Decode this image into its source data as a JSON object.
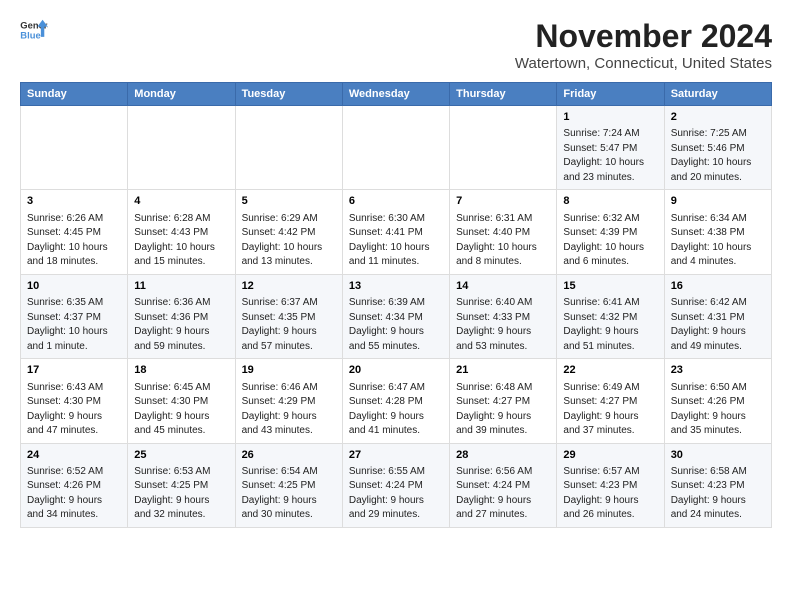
{
  "header": {
    "logo_line1": "General",
    "logo_line2": "Blue",
    "title": "November 2024",
    "subtitle": "Watertown, Connecticut, United States"
  },
  "weekdays": [
    "Sunday",
    "Monday",
    "Tuesday",
    "Wednesday",
    "Thursday",
    "Friday",
    "Saturday"
  ],
  "weeks": [
    [
      {
        "day": "",
        "info": ""
      },
      {
        "day": "",
        "info": ""
      },
      {
        "day": "",
        "info": ""
      },
      {
        "day": "",
        "info": ""
      },
      {
        "day": "",
        "info": ""
      },
      {
        "day": "1",
        "info": "Sunrise: 7:24 AM\nSunset: 5:47 PM\nDaylight: 10 hours\nand 23 minutes."
      },
      {
        "day": "2",
        "info": "Sunrise: 7:25 AM\nSunset: 5:46 PM\nDaylight: 10 hours\nand 20 minutes."
      }
    ],
    [
      {
        "day": "3",
        "info": "Sunrise: 6:26 AM\nSunset: 4:45 PM\nDaylight: 10 hours\nand 18 minutes."
      },
      {
        "day": "4",
        "info": "Sunrise: 6:28 AM\nSunset: 4:43 PM\nDaylight: 10 hours\nand 15 minutes."
      },
      {
        "day": "5",
        "info": "Sunrise: 6:29 AM\nSunset: 4:42 PM\nDaylight: 10 hours\nand 13 minutes."
      },
      {
        "day": "6",
        "info": "Sunrise: 6:30 AM\nSunset: 4:41 PM\nDaylight: 10 hours\nand 11 minutes."
      },
      {
        "day": "7",
        "info": "Sunrise: 6:31 AM\nSunset: 4:40 PM\nDaylight: 10 hours\nand 8 minutes."
      },
      {
        "day": "8",
        "info": "Sunrise: 6:32 AM\nSunset: 4:39 PM\nDaylight: 10 hours\nand 6 minutes."
      },
      {
        "day": "9",
        "info": "Sunrise: 6:34 AM\nSunset: 4:38 PM\nDaylight: 10 hours\nand 4 minutes."
      }
    ],
    [
      {
        "day": "10",
        "info": "Sunrise: 6:35 AM\nSunset: 4:37 PM\nDaylight: 10 hours\nand 1 minute."
      },
      {
        "day": "11",
        "info": "Sunrise: 6:36 AM\nSunset: 4:36 PM\nDaylight: 9 hours\nand 59 minutes."
      },
      {
        "day": "12",
        "info": "Sunrise: 6:37 AM\nSunset: 4:35 PM\nDaylight: 9 hours\nand 57 minutes."
      },
      {
        "day": "13",
        "info": "Sunrise: 6:39 AM\nSunset: 4:34 PM\nDaylight: 9 hours\nand 55 minutes."
      },
      {
        "day": "14",
        "info": "Sunrise: 6:40 AM\nSunset: 4:33 PM\nDaylight: 9 hours\nand 53 minutes."
      },
      {
        "day": "15",
        "info": "Sunrise: 6:41 AM\nSunset: 4:32 PM\nDaylight: 9 hours\nand 51 minutes."
      },
      {
        "day": "16",
        "info": "Sunrise: 6:42 AM\nSunset: 4:31 PM\nDaylight: 9 hours\nand 49 minutes."
      }
    ],
    [
      {
        "day": "17",
        "info": "Sunrise: 6:43 AM\nSunset: 4:30 PM\nDaylight: 9 hours\nand 47 minutes."
      },
      {
        "day": "18",
        "info": "Sunrise: 6:45 AM\nSunset: 4:30 PM\nDaylight: 9 hours\nand 45 minutes."
      },
      {
        "day": "19",
        "info": "Sunrise: 6:46 AM\nSunset: 4:29 PM\nDaylight: 9 hours\nand 43 minutes."
      },
      {
        "day": "20",
        "info": "Sunrise: 6:47 AM\nSunset: 4:28 PM\nDaylight: 9 hours\nand 41 minutes."
      },
      {
        "day": "21",
        "info": "Sunrise: 6:48 AM\nSunset: 4:27 PM\nDaylight: 9 hours\nand 39 minutes."
      },
      {
        "day": "22",
        "info": "Sunrise: 6:49 AM\nSunset: 4:27 PM\nDaylight: 9 hours\nand 37 minutes."
      },
      {
        "day": "23",
        "info": "Sunrise: 6:50 AM\nSunset: 4:26 PM\nDaylight: 9 hours\nand 35 minutes."
      }
    ],
    [
      {
        "day": "24",
        "info": "Sunrise: 6:52 AM\nSunset: 4:26 PM\nDaylight: 9 hours\nand 34 minutes."
      },
      {
        "day": "25",
        "info": "Sunrise: 6:53 AM\nSunset: 4:25 PM\nDaylight: 9 hours\nand 32 minutes."
      },
      {
        "day": "26",
        "info": "Sunrise: 6:54 AM\nSunset: 4:25 PM\nDaylight: 9 hours\nand 30 minutes."
      },
      {
        "day": "27",
        "info": "Sunrise: 6:55 AM\nSunset: 4:24 PM\nDaylight: 9 hours\nand 29 minutes."
      },
      {
        "day": "28",
        "info": "Sunrise: 6:56 AM\nSunset: 4:24 PM\nDaylight: 9 hours\nand 27 minutes."
      },
      {
        "day": "29",
        "info": "Sunrise: 6:57 AM\nSunset: 4:23 PM\nDaylight: 9 hours\nand 26 minutes."
      },
      {
        "day": "30",
        "info": "Sunrise: 6:58 AM\nSunset: 4:23 PM\nDaylight: 9 hours\nand 24 minutes."
      }
    ]
  ]
}
